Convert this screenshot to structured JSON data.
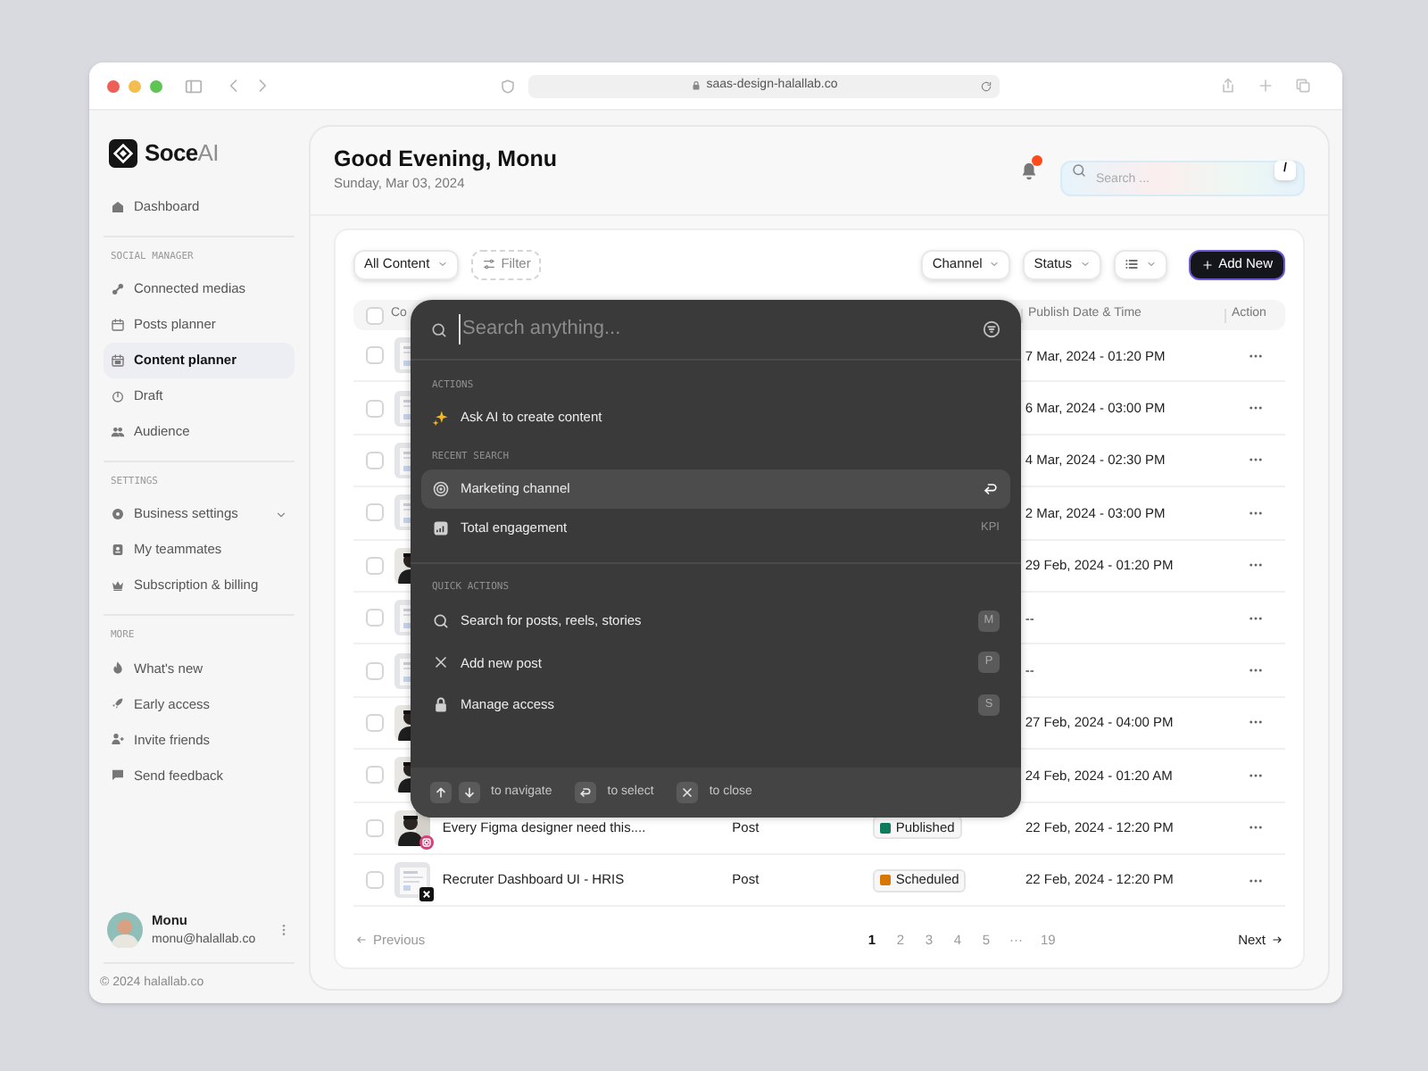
{
  "browser": {
    "url": "saas-design-halallab.co"
  },
  "sidebar": {
    "brand": {
      "main": "Soce",
      "accent": "AI"
    },
    "sections": [
      {
        "items": [
          {
            "label": "Dashboard",
            "selected": false,
            "has_submenu": false
          }
        ]
      },
      {
        "heading": "SOCIAL MANAGER",
        "items": [
          {
            "label": "Connected medias",
            "selected": false,
            "has_submenu": false
          },
          {
            "label": "Posts planner",
            "selected": false,
            "has_submenu": false
          },
          {
            "label": "Content planner",
            "selected": true,
            "has_submenu": false
          },
          {
            "label": "Draft",
            "selected": false,
            "has_submenu": false
          },
          {
            "label": "Audience",
            "selected": false,
            "has_submenu": false
          }
        ]
      },
      {
        "heading": "SETTINGS",
        "items": [
          {
            "label": "Business settings",
            "selected": false,
            "has_submenu": true
          },
          {
            "label": "My teammates",
            "selected": false,
            "has_submenu": false
          },
          {
            "label": "Subscription & billing",
            "selected": false,
            "has_submenu": false
          }
        ]
      },
      {
        "heading": "MORE",
        "items": [
          {
            "label": "What's new",
            "selected": false,
            "has_submenu": false
          },
          {
            "label": "Early access",
            "selected": false,
            "has_submenu": false
          },
          {
            "label": "Invite friends",
            "selected": false,
            "has_submenu": false
          },
          {
            "label": "Send feedback",
            "selected": false,
            "has_submenu": false
          }
        ]
      }
    ],
    "user": {
      "name": "Monu",
      "email": "monu@halallab.co"
    },
    "footer": "© 2024 halallab.co"
  },
  "header": {
    "greeting": "Good Evening, Monu",
    "date": "Sunday, Mar 03, 2024",
    "notifications": {
      "unread": true
    },
    "search": {
      "placeholder": "Search ...",
      "shortcut": "/"
    }
  },
  "toolbar": {
    "content_filter": "All Content",
    "filter": "Filter",
    "dropdowns": [
      "Channel",
      "Status"
    ],
    "add_button": "Add New"
  },
  "table": {
    "select_all": {
      "checked": false
    },
    "columns": [
      {
        "label": "Co"
      },
      {
        "label": "Publish Date & Time"
      },
      {
        "label": "Action"
      }
    ],
    "rows": [
      {
        "checked": false,
        "date": "7 Mar, 2024 - 01:20 PM",
        "badge": false
      },
      {
        "checked": false,
        "date": "6 Mar, 2024 - 03:00 PM",
        "badge": false
      },
      {
        "checked": false,
        "date": "4 Mar, 2024 - 02:30 PM",
        "badge": false
      },
      {
        "checked": false,
        "date": "2 Mar, 2024 - 03:00 PM",
        "badge": false
      },
      {
        "checked": false,
        "date": "29 Feb, 2024 - 01:20 PM",
        "badge": false
      },
      {
        "checked": false,
        "date": "--",
        "badge": false
      },
      {
        "checked": false,
        "date": "--",
        "badge": false
      },
      {
        "checked": false,
        "date": "27 Feb, 2024 - 04:00 PM",
        "badge": false
      },
      {
        "checked": false,
        "date": "24 Feb, 2024 - 01:20 AM",
        "badge": false
      },
      {
        "checked": false,
        "title": "Every Figma designer need this....",
        "type": "Post",
        "status": {
          "label": "Published",
          "color": "#0f7a5c"
        },
        "date": "22 Feb, 2024 - 12:20 PM",
        "badge": true
      },
      {
        "checked": false,
        "title": "Recruter Dashboard UI - HRIS",
        "type": "Post",
        "status": {
          "label": "Scheduled",
          "color": "#d97706"
        },
        "date": "22 Feb, 2024 - 12:20 PM",
        "badge": true
      }
    ]
  },
  "pagination": {
    "previous": "Previous",
    "pages": [
      {
        "label": "1",
        "selected": true
      },
      {
        "label": "2",
        "selected": false
      },
      {
        "label": "3",
        "selected": false
      },
      {
        "label": "4",
        "selected": false
      },
      {
        "label": "5",
        "selected": false
      },
      {
        "label": "···",
        "selected": false
      },
      {
        "label": "19",
        "selected": false
      }
    ],
    "next": "Next"
  },
  "palette": {
    "placeholder": "Search anything...",
    "sections": [
      {
        "heading": "ACTIONS",
        "items": [
          {
            "label": "Ask AI to create content",
            "selected": false
          }
        ]
      },
      {
        "heading": "RECENT SEARCH",
        "items": [
          {
            "label": "Marketing channel",
            "selected": true
          },
          {
            "label": "Total engagement",
            "selected": false,
            "hint": "KPI"
          }
        ]
      },
      {
        "heading": "QUICK ACTIONS",
        "items": [
          {
            "label": "Search for posts, reels, stories",
            "selected": false,
            "key": "M"
          },
          {
            "label": "Add new post",
            "selected": false,
            "key": "P"
          },
          {
            "label": "Manage access",
            "selected": false,
            "key": "S"
          }
        ]
      }
    ],
    "footer": [
      {
        "label": "to navigate"
      },
      {
        "label": "to select"
      },
      {
        "label": "to close"
      }
    ]
  }
}
